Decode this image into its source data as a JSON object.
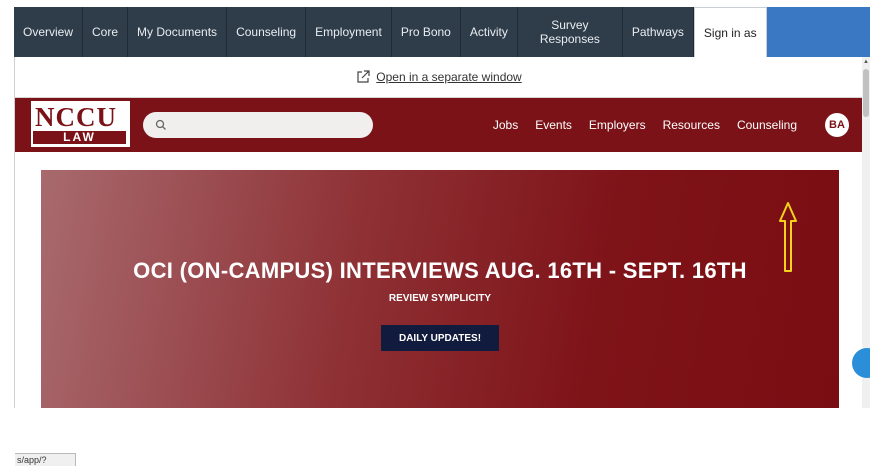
{
  "tabs": [
    {
      "label": "Overview"
    },
    {
      "label": "Core"
    },
    {
      "label": "My Documents"
    },
    {
      "label": "Counseling"
    },
    {
      "label": "Employment"
    },
    {
      "label": "Pro Bono"
    },
    {
      "label": "Activity"
    },
    {
      "label": "Survey Responses"
    },
    {
      "label": "Pathways"
    },
    {
      "label": "Sign in as"
    }
  ],
  "open_link": {
    "label": "Open in a separate window"
  },
  "logo": {
    "line1": "NCCU",
    "line2": "LAW"
  },
  "nav": {
    "jobs": "Jobs",
    "events": "Events",
    "employers": "Employers",
    "resources": "Resources",
    "counseling": "Counseling"
  },
  "avatar": {
    "initials": "BA"
  },
  "hero": {
    "title": "OCI (ON-CAMPUS) INTERVIEWS AUG. 16TH - SEPT. 16TH",
    "subtitle": "REVIEW SYMPLICITY",
    "button": "DAILY UPDATES!"
  },
  "status_url": "s/app/?",
  "colors": {
    "brand": "#7a1217",
    "tabbar": "#2f3c49",
    "button": "#101b3e",
    "annotation_arrow": "#f2d21b"
  }
}
